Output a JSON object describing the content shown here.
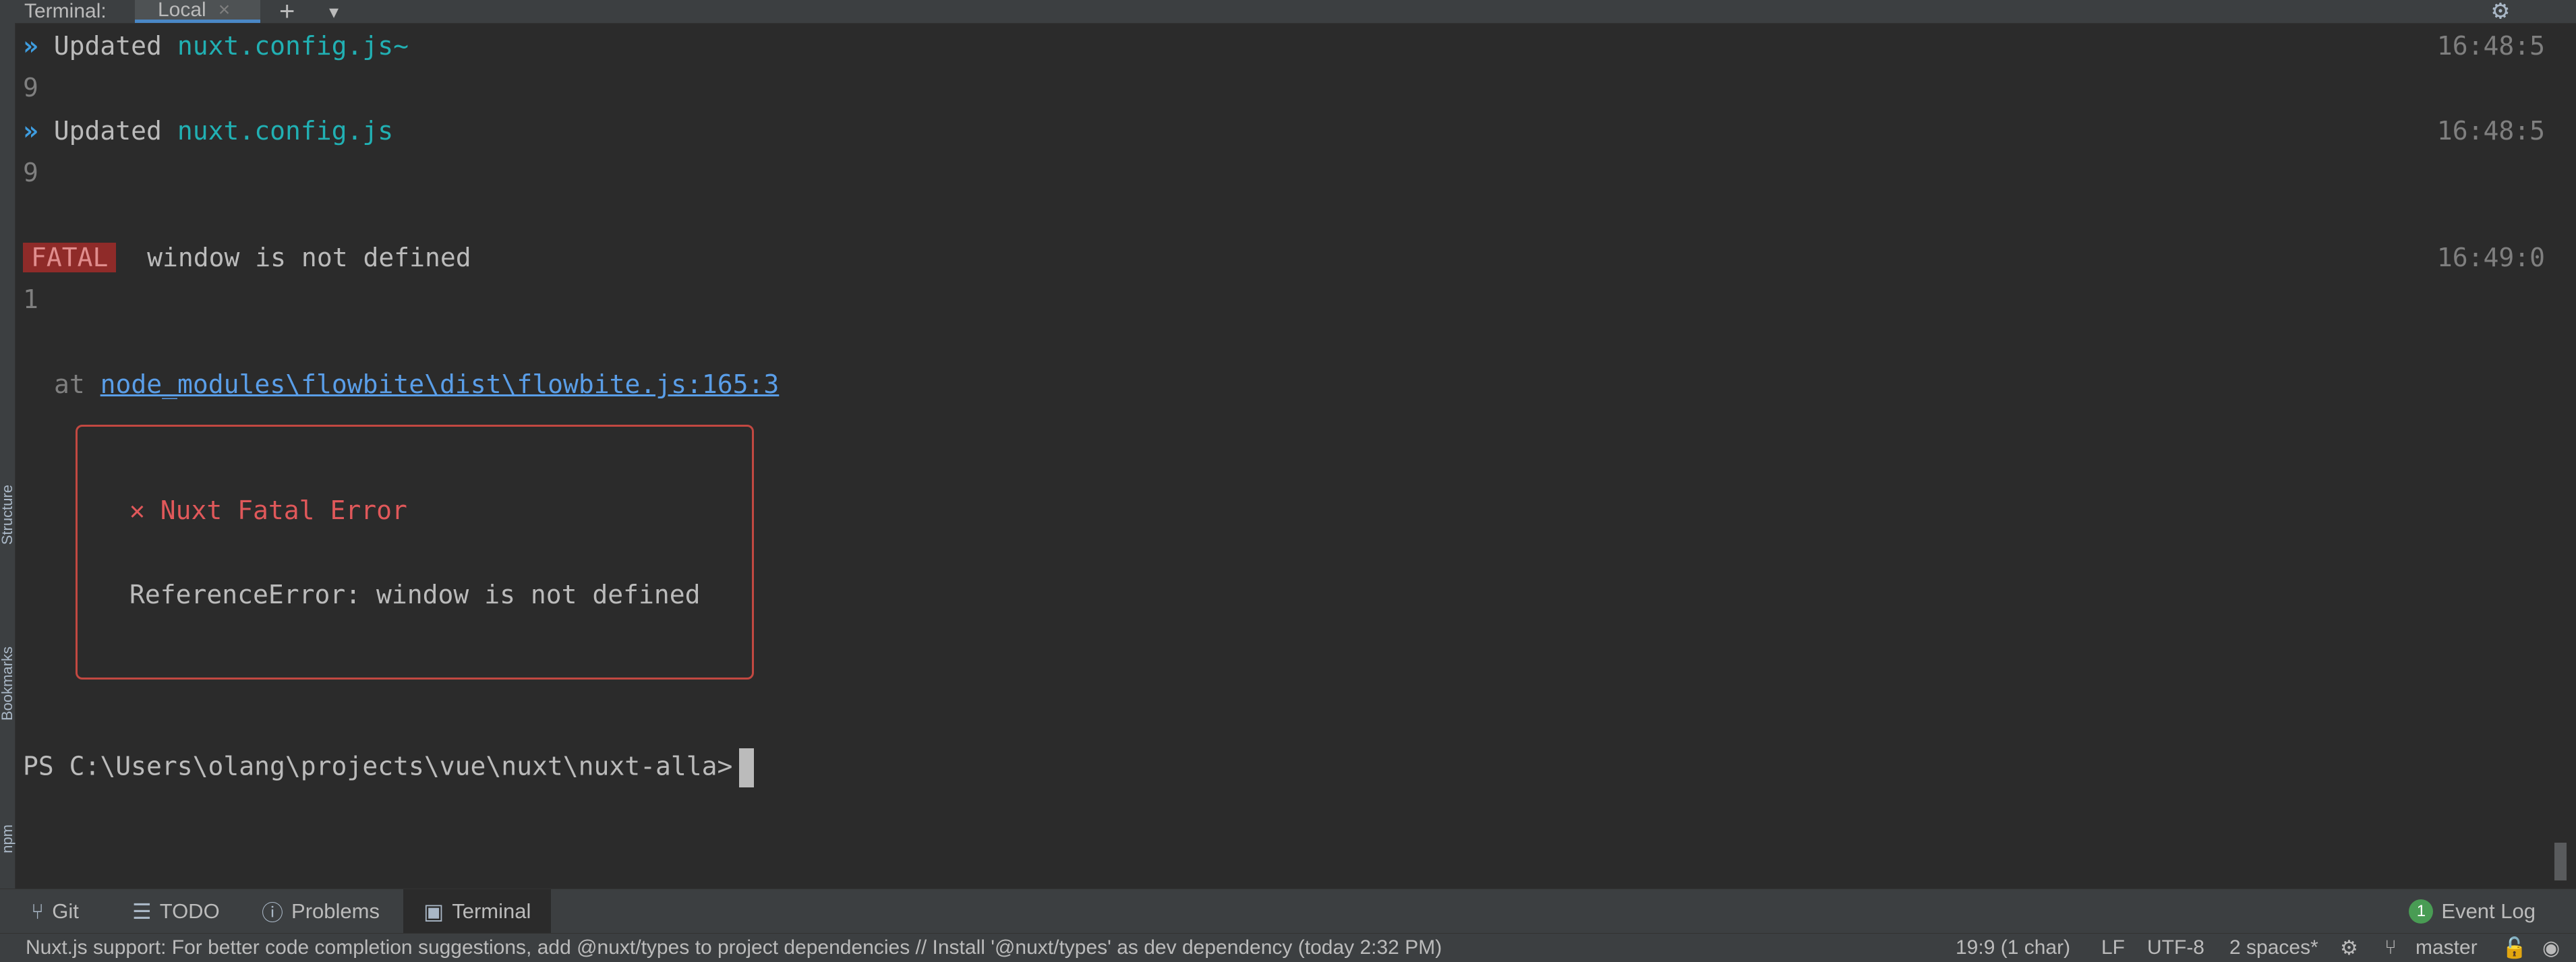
{
  "tabs": {
    "title": "Terminal:",
    "local": "Local",
    "close_glyph": "×",
    "add_glyph": "+",
    "dropdown_glyph": "▾"
  },
  "sidebar": [
    {
      "label": "Structure"
    },
    {
      "label": "Bookmarks"
    },
    {
      "label": "npm"
    }
  ],
  "terminal": {
    "lines": [
      {
        "prefix": "»",
        "text": "Updated ",
        "file": "nuxt.config.js~",
        "time": "16:48:5",
        "wrap": "9"
      },
      {
        "prefix": "»",
        "text": "Updated ",
        "file": "nuxt.config.js",
        "time": "16:48:5",
        "wrap": "9"
      }
    ],
    "fatal": {
      "badge": "FATAL",
      "message": "window is not defined",
      "time": "16:49:0",
      "wrap": "1"
    },
    "stack_at": "at",
    "stack_link": "node_modules\\flowbite\\dist\\flowbite.js:165:3",
    "error_box": {
      "icon": "✕",
      "title": "Nuxt Fatal Error",
      "detail": "ReferenceError: window is not defined"
    },
    "prompt": "PS C:\\Users\\olang\\projects\\vue\\nuxt\\nuxt-alla>"
  },
  "toolwindows": [
    {
      "icon": "git-branch-icon",
      "label": "Git"
    },
    {
      "icon": "list-icon",
      "label": "TODO"
    },
    {
      "icon": "info-icon",
      "label": "Problems"
    },
    {
      "icon": "terminal-icon",
      "label": "Terminal"
    }
  ],
  "event_log": {
    "count": "1",
    "label": "Event Log"
  },
  "status": {
    "message": "Nuxt.js support: For better code completion suggestions, add @nuxt/types to project dependencies // Install '@nuxt/types' as dev dependency (today 2:32 PM)",
    "position": "19:9 (1 char)",
    "line_sep": "LF",
    "encoding": "UTF-8",
    "indent": "2 spaces*",
    "branch": "master"
  },
  "colors": {
    "background": "#2b2b2b",
    "chrome": "#3c3f41",
    "accent": "#4a88c7",
    "error": "#c24841",
    "filename": "#21b0b3"
  }
}
